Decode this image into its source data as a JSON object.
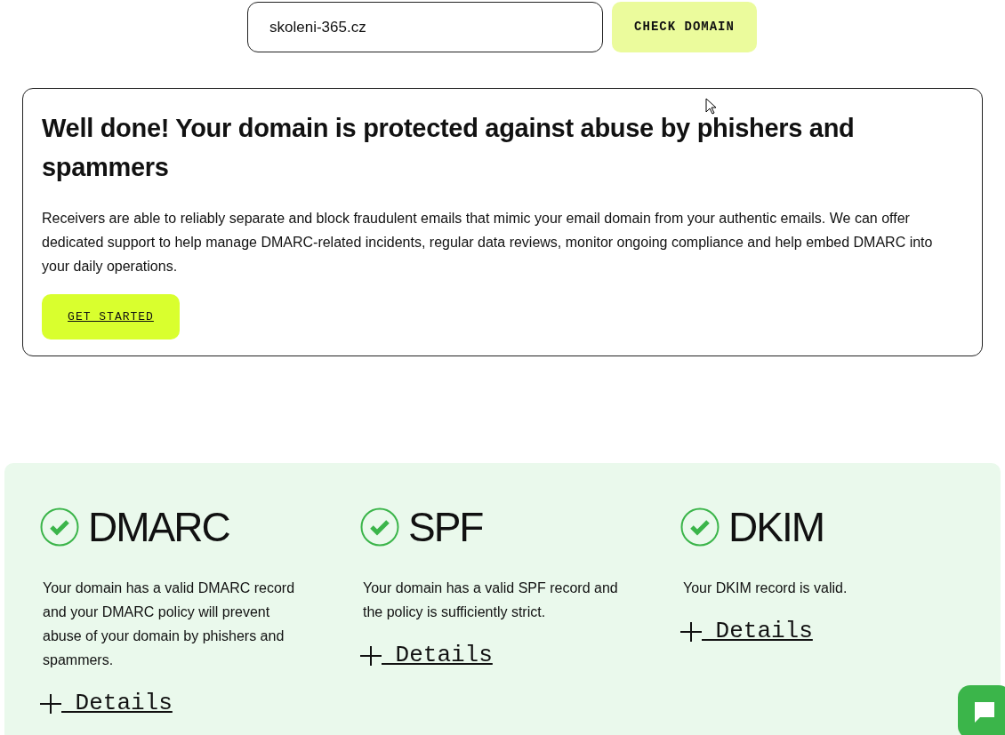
{
  "search": {
    "value": "skoleni-365.cz",
    "button": "CHECK DOMAIN"
  },
  "result": {
    "title": "Well done! Your domain is protected against abuse by phishers and spammers",
    "text": "Receivers are able to reliably separate and block fraudulent emails that mimic your email domain from your authentic emails. We can offer dedicated support to help manage DMARC-related incidents, regular data reviews, monitor ongoing compliance and help embed DMARC into your daily operations.",
    "button": "GET STARTED"
  },
  "checks": [
    {
      "name": "DMARC",
      "valid": true,
      "text": "Your domain has a valid DMARC record and your DMARC policy will prevent abuse of your domain by phishers and spammers.",
      "details": " Details"
    },
    {
      "name": "SPF",
      "valid": true,
      "text": "Your domain has a valid SPF record and the policy is sufficiently strict.",
      "details": " Details"
    },
    {
      "name": "DKIM",
      "valid": true,
      "text": "Your DKIM record is valid.",
      "details": " Details"
    }
  ]
}
